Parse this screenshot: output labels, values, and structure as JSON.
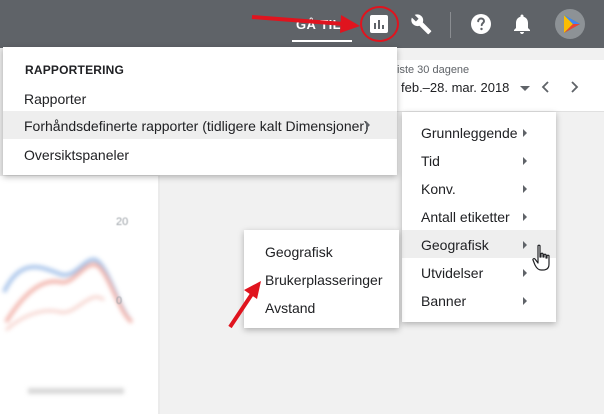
{
  "topbar": {
    "goto_label": "GÅ TIL",
    "icons": [
      "reports-icon",
      "tools-wrench-icon",
      "help-icon",
      "notifications-bell-icon",
      "account-avatar-icon"
    ]
  },
  "date_range": {
    "sublabel": "iste 30 dagene",
    "value": "feb.–28. mar. 2018"
  },
  "menu_reporting": {
    "header": "RAPPORTERING",
    "items": [
      {
        "label": "Rapporter"
      },
      {
        "label": "Forhåndsdefinerte rapporter (tidligere kalt Dimensjoner)"
      },
      {
        "label": "Oversiktspaneler"
      }
    ]
  },
  "menu_predefined": {
    "items": [
      {
        "label": "Grunnleggende"
      },
      {
        "label": "Tid"
      },
      {
        "label": "Konv."
      },
      {
        "label": "Antall etiketter"
      },
      {
        "label": "Geografisk"
      },
      {
        "label": "Utvidelser"
      },
      {
        "label": "Banner"
      }
    ]
  },
  "menu_geo": {
    "items": [
      {
        "label": "Geografisk"
      },
      {
        "label": "Brukerplasseringer"
      },
      {
        "label": "Avstand"
      }
    ]
  },
  "chart": {
    "tick_top": "20",
    "tick_mid": "0"
  },
  "colors": {
    "topbar": "#5f6368",
    "annotation_red": "#e0141e",
    "menu_highlight": "#eeeeee"
  }
}
